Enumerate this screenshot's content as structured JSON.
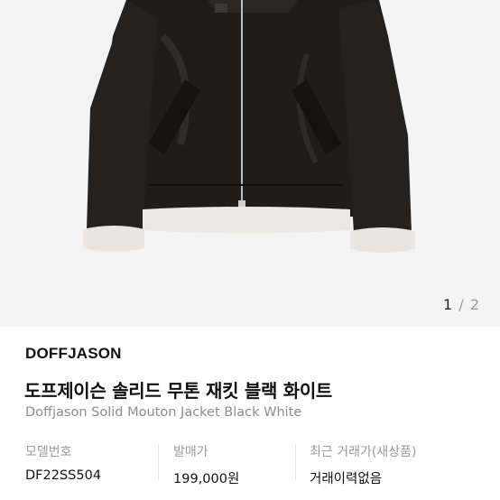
{
  "product_image": {
    "description_icon": "leather-shearling-jacket-photo",
    "pager": {
      "current": "1",
      "separator": "/",
      "total": "2"
    }
  },
  "product": {
    "brand": "DOFFJASON",
    "title_ko": "도프제이슨 솔리드 무톤 재킷 블랙 화이트",
    "title_en": "Doffjason Solid Mouton Jacket Black White"
  },
  "info": {
    "model": {
      "label": "모델번호",
      "value": "DF22SS504"
    },
    "release_price": {
      "label": "발매가",
      "value": "199,000원"
    },
    "recent_trade": {
      "label": "최근 거래가(새상품)",
      "value": "거래이력없음"
    }
  },
  "colors": {
    "image_bg": "#f3f3f3",
    "jacket": "#1f1d1c",
    "shearling": "#ece9e4",
    "muted_text": "#9a9a9a"
  }
}
